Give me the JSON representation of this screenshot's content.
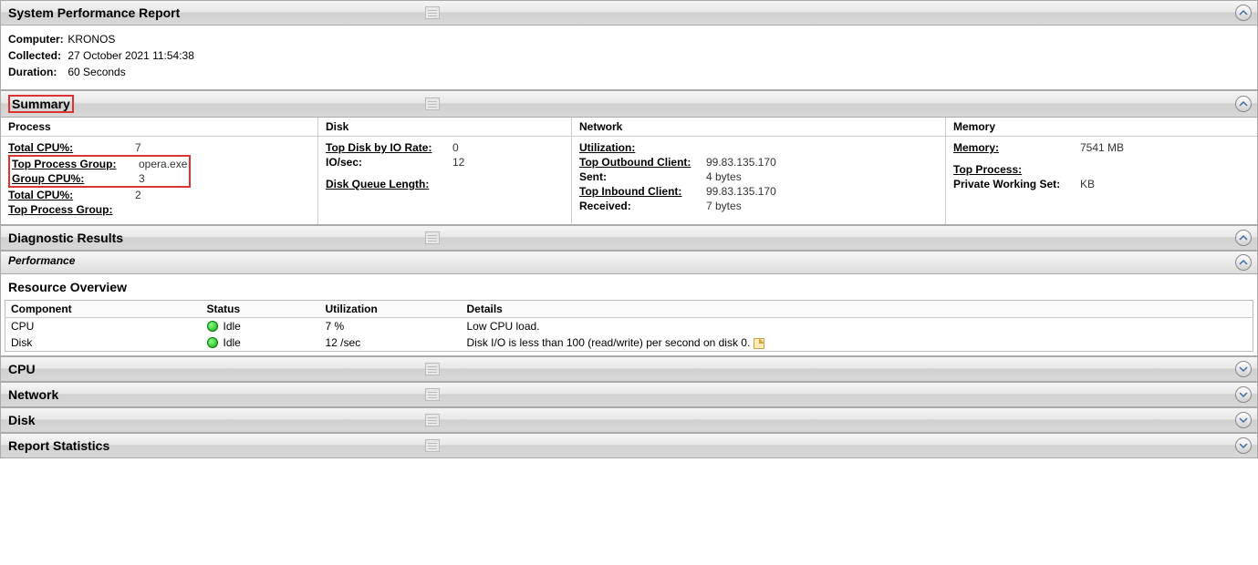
{
  "report": {
    "title": "System Performance Report",
    "computer_label": "Computer:",
    "computer": "KRONOS",
    "collected_label": "Collected:",
    "collected": "27 October 2021 11:54:38",
    "duration_label": "Duration:",
    "duration": "60 Seconds"
  },
  "summary": {
    "title": "Summary",
    "process": {
      "header": "Process",
      "total_cpu_label": "Total CPU%:",
      "total_cpu": "7",
      "top_proc_group_label": "Top Process Group:",
      "top_proc_group": "opera.exe",
      "group_cpu_label": "Group CPU%:",
      "group_cpu": "3",
      "total_cpu2": "2",
      "top_proc_group2_label": "Top Process Group:"
    },
    "disk": {
      "header": "Disk",
      "top_io_label": "Top Disk by IO Rate:",
      "top_io": "0",
      "iosec_label": "IO/sec:",
      "iosec": "12",
      "queue_label": "Disk Queue Length:"
    },
    "network": {
      "header": "Network",
      "util_label": "Utilization:",
      "out_client_label": "Top Outbound Client:",
      "out_client": "99.83.135.170",
      "sent_label": "Sent:",
      "sent": "4 bytes",
      "in_client_label": "Top Inbound Client:",
      "in_client": "99.83.135.170",
      "recv_label": "Received:",
      "recv": "7 bytes"
    },
    "memory": {
      "header": "Memory",
      "mem_label": "Memory:",
      "mem": "7541 MB",
      "top_proc_label": "Top Process:",
      "pws_label": "Private Working Set:",
      "pws": "KB"
    }
  },
  "diag": {
    "title": "Diagnostic Results"
  },
  "perf": {
    "title": "Performance"
  },
  "resource": {
    "title": "Resource Overview",
    "cols": {
      "component": "Component",
      "status": "Status",
      "util": "Utilization",
      "details": "Details"
    },
    "rows": [
      {
        "component": "CPU",
        "status": "Idle",
        "util": "7 %",
        "details": "Low CPU load."
      },
      {
        "component": "Disk",
        "status": "Idle",
        "util": "12 /sec",
        "details": "Disk I/O is less than 100 (read/write) per second on disk 0."
      }
    ]
  },
  "cpu": {
    "title": "CPU"
  },
  "net": {
    "title": "Network"
  },
  "dsk": {
    "title": "Disk"
  },
  "stats": {
    "title": "Report Statistics"
  }
}
